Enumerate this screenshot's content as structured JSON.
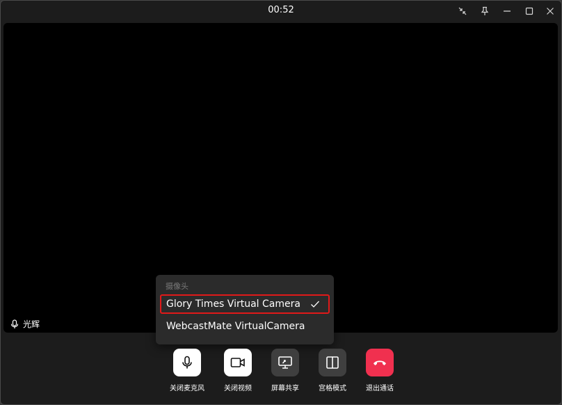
{
  "titlebar": {
    "timer": "00:52"
  },
  "video": {
    "participant_name": "光辉"
  },
  "camera_menu": {
    "header": "摄像头",
    "items": [
      {
        "label": "Glory Times Virtual Camera",
        "selected": true
      },
      {
        "label": "WebcastMate VirtualCamera",
        "selected": false
      }
    ]
  },
  "controls": {
    "mute_label": "关闭麦克风",
    "video_label": "关闭视频",
    "share_label": "屏幕共享",
    "grid_label": "宫格模式",
    "hangup_label": "退出通话"
  },
  "colors": {
    "hangup": "#f0304f",
    "highlight_border": "#e11919"
  }
}
